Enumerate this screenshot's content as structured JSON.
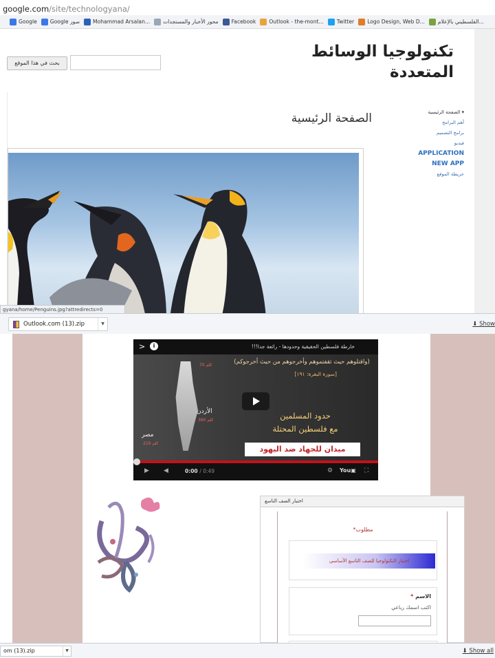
{
  "browser": {
    "url_host": "google.com",
    "url_path": "/site/technologyana/",
    "bookmarks": [
      {
        "label": "Google",
        "icon": "google-icon",
        "color": "#3b78e7"
      },
      {
        "label": "Google صور",
        "icon": "google-icon",
        "color": "#3b78e7"
      },
      {
        "label": "Mohammad Arsalan...",
        "icon": "blogger-icon",
        "color": "#2b62b9"
      },
      {
        "label": "محور الأخبار والمستجدات",
        "icon": "page-icon",
        "color": "#9aa7b7"
      },
      {
        "label": "Facebook",
        "icon": "facebook-icon",
        "color": "#3b5998"
      },
      {
        "label": "Outlook - the-mont...",
        "icon": "outlook-icon",
        "color": "#e8a33d"
      },
      {
        "label": "Twitter",
        "icon": "twitter-icon",
        "color": "#1da1f2"
      },
      {
        "label": "Logo Design, Web D...",
        "icon": "logo-icon",
        "color": "#e07b2a"
      },
      {
        "label": "الفلسطيني بالإعلام...",
        "icon": "page-icon",
        "color": "#7aa33c"
      }
    ]
  },
  "site": {
    "title": "تكنولوجيا الوسائط المتعددة",
    "search_button": "بحث في هذا الموقع",
    "page_heading": "الصفحة الرئيسية",
    "nav": [
      "▾ الصفحة الرئيسية",
      "أهم البرامج",
      "برامج التصميم",
      "فيديو",
      "APPLICATION",
      "NEW APP",
      "خريطة الموقع"
    ],
    "status_url": "gyana/home/Penguins.jpg?attredirects=0"
  },
  "downloads": {
    "file_top": "Outlook.com (13).zip",
    "show_all_top": "Show",
    "file_bottom": "om (13).zip",
    "show_all_bottom": "Show all"
  },
  "video": {
    "title": "خارطة فلسطين الحقيقية وحدودها - رائعة جدا!!!",
    "quote": "(واقتلوهم حيث ثقفتموهم وأخرجوهم من حيث أخرجوكم)",
    "sura": "[سورة البقرة: ١٩١]",
    "label_jordan": "الأردن",
    "label_jordan_km": "360 كلم",
    "label_egypt": "مصر",
    "label_egypt_km": "210 كلم",
    "label_top_km": "70 كلم",
    "main_line1": "حدود المسلمين",
    "main_line2": "مع فلسطين المحتلة",
    "banner": "ميدان للجهاد ضد اليهود",
    "time_current": "0:00",
    "time_total": "/ 0:49",
    "progress": 0
  },
  "form": {
    "header": "اختبار الصف التاسع",
    "required_note": "مطلوب*",
    "quiz_title": "اختبار التكنولوجيا للصف التاسع الأساسي",
    "name_label": "الاسم",
    "name_required": "*",
    "name_help": "اكتب اسمك رباعي"
  }
}
